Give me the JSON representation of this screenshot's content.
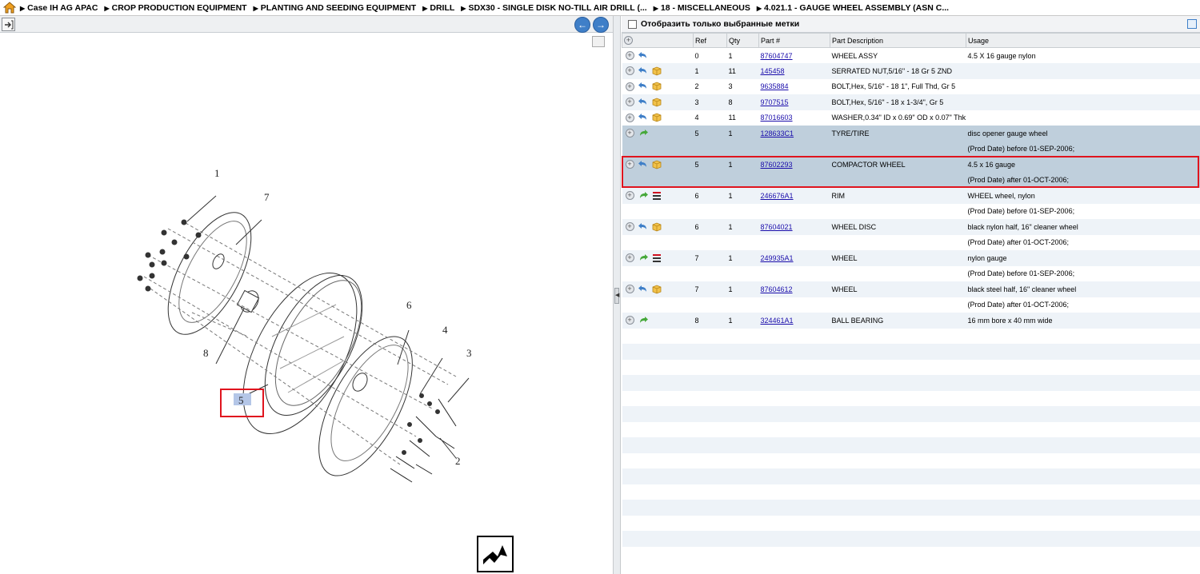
{
  "breadcrumb": [
    "Case IH AG APAC",
    "CROP PRODUCTION EQUIPMENT",
    "PLANTING AND SEEDING EQUIPMENT",
    "DRILL",
    "SDX30 - SINGLE DISK NO-TILL AIR DRILL (...",
    "18 - MISCELLANEOUS",
    "4.021.1 - GAUGE WHEEL ASSEMBLY (ASN C..."
  ],
  "icons": {
    "home": "home-icon",
    "export": "export-icon",
    "prev": "arrow-left-icon",
    "next": "arrow-right-icon"
  },
  "filter_label": "Отобразить только выбранные метки",
  "table": {
    "headers": [
      "Ref",
      "Qty",
      "Part #",
      "Part Description",
      "Usage"
    ],
    "rows": [
      {
        "ref": "0",
        "qty": "1",
        "part": "87604747",
        "desc": "WHEEL ASSY",
        "usage": "4.5 X 16 gauge nylon",
        "usage2": "",
        "sym": "back",
        "sym2": ""
      },
      {
        "ref": "1",
        "qty": "11",
        "part": "145458",
        "desc": "SERRATED NUT,5/16\" - 18 Gr 5 ZND",
        "usage": "",
        "usage2": "",
        "sym": "back",
        "sym2": "box"
      },
      {
        "ref": "2",
        "qty": "3",
        "part": "9635884",
        "desc": "BOLT,Hex, 5/16\" - 18 1\", Full Thd, Gr 5",
        "usage": "",
        "usage2": "",
        "sym": "back",
        "sym2": "box"
      },
      {
        "ref": "3",
        "qty": "8",
        "part": "9707515",
        "desc": "BOLT,Hex, 5/16\" - 18  x 1-3/4\", Gr 5",
        "usage": "",
        "usage2": "",
        "sym": "back",
        "sym2": "box"
      },
      {
        "ref": "4",
        "qty": "11",
        "part": "87016603",
        "desc": "WASHER,0.34\" ID x 0.69\" OD x 0.07\" Thk",
        "usage": "",
        "usage2": "",
        "sym": "back",
        "sym2": "box"
      },
      {
        "ref": "5",
        "qty": "1",
        "part": "128633C1",
        "desc": "TYRE/TIRE",
        "usage": "disc opener gauge wheel",
        "usage2": "(Prod Date) before 01-SEP-2006;",
        "sym": "fwd",
        "sym2": ""
      },
      {
        "ref": "5",
        "qty": "1",
        "part": "87602293",
        "desc": "COMPACTOR WHEEL",
        "usage": "4.5 x 16 gauge",
        "usage2": "(Prod Date) after 01-OCT-2006;",
        "sym": "back",
        "sym2": "box"
      },
      {
        "ref": "6",
        "qty": "1",
        "part": "246676A1",
        "desc": "RIM",
        "usage": "WHEEL wheel, nylon",
        "usage2": "(Prod Date) before 01-SEP-2006;",
        "sym": "fwd",
        "sym2": "list"
      },
      {
        "ref": "6",
        "qty": "1",
        "part": "87604021",
        "desc": "WHEEL DISC",
        "usage": "black nylon half, 16\" cleaner wheel",
        "usage2": "(Prod Date) after 01-OCT-2006;",
        "sym": "back",
        "sym2": "box"
      },
      {
        "ref": "7",
        "qty": "1",
        "part": "249935A1",
        "desc": "WHEEL",
        "usage": "nylon gauge",
        "usage2": "(Prod Date) before 01-SEP-2006;",
        "sym": "fwd",
        "sym2": "list"
      },
      {
        "ref": "7",
        "qty": "1",
        "part": "87604612",
        "desc": "WHEEL",
        "usage": "black steel half, 16\" cleaner wheel",
        "usage2": "(Prod Date) after 01-OCT-2006;",
        "sym": "back",
        "sym2": "box"
      },
      {
        "ref": "8",
        "qty": "1",
        "part": "324461A1",
        "desc": "BALL BEARING",
        "usage": "16 mm bore x 40 mm wide",
        "usage2": "",
        "sym": "fwd",
        "sym2": ""
      }
    ]
  },
  "diagram": {
    "callouts": [
      "1",
      "7",
      "8",
      "6",
      "4",
      "3",
      "5",
      "2"
    ],
    "highlighted_callout": "5"
  },
  "colors": {
    "accent": "#3f7fc8",
    "selected_row": "#bfcfdc",
    "highlight_border": "#e0141e",
    "link": "#1a0dab"
  }
}
